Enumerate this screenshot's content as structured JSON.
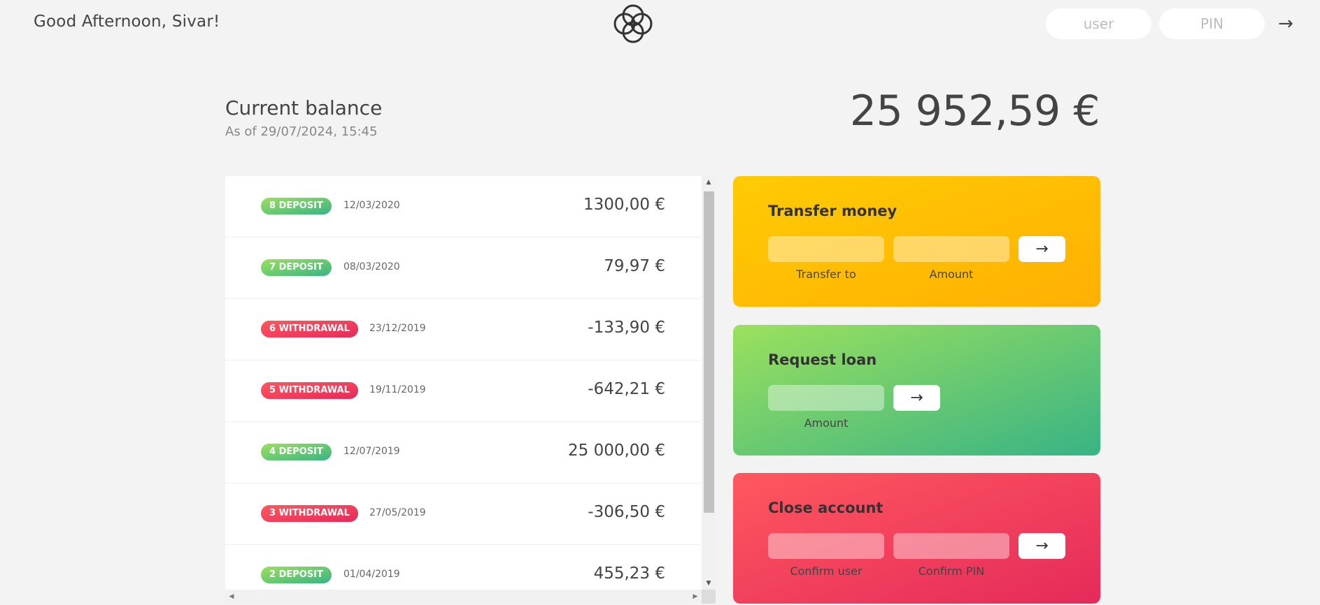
{
  "nav": {
    "welcome": "Good Afternoon, Sivar!",
    "login_user_placeholder": "user",
    "login_pin_placeholder": "PIN",
    "login_button": "→"
  },
  "balance": {
    "label": "Current balance",
    "date": "As of 29/07/2024, 15:45",
    "value": "25 952,59 €"
  },
  "movements": [
    {
      "type": "8 DEPOSIT",
      "kind": "deposit",
      "date": "12/03/2020",
      "value": "1300,00 €"
    },
    {
      "type": "7 DEPOSIT",
      "kind": "deposit",
      "date": "08/03/2020",
      "value": "79,97 €"
    },
    {
      "type": "6 WITHDRAWAL",
      "kind": "withdrawal",
      "date": "23/12/2019",
      "value": "-133,90 €"
    },
    {
      "type": "5 WITHDRAWAL",
      "kind": "withdrawal",
      "date": "19/11/2019",
      "value": "-642,21 €"
    },
    {
      "type": "4 DEPOSIT",
      "kind": "deposit",
      "date": "12/07/2019",
      "value": "25 000,00 €"
    },
    {
      "type": "3 WITHDRAWAL",
      "kind": "withdrawal",
      "date": "27/05/2019",
      "value": "-306,50 €"
    },
    {
      "type": "2 DEPOSIT",
      "kind": "deposit",
      "date": "01/04/2019",
      "value": "455,23 €"
    }
  ],
  "operations": {
    "transfer": {
      "title": "Transfer money",
      "label_to": "Transfer to",
      "label_amount": "Amount",
      "button": "→"
    },
    "loan": {
      "title": "Request loan",
      "label_amount": "Amount",
      "button": "→"
    },
    "close": {
      "title": "Close account",
      "label_user": "Confirm user",
      "label_pin": "Confirm PIN",
      "button": "→"
    }
  },
  "colors": {
    "deposit": "#39b385",
    "withdrawal": "#e52a5a",
    "transfer": "#ffb003",
    "background": "#f3f3f3"
  }
}
